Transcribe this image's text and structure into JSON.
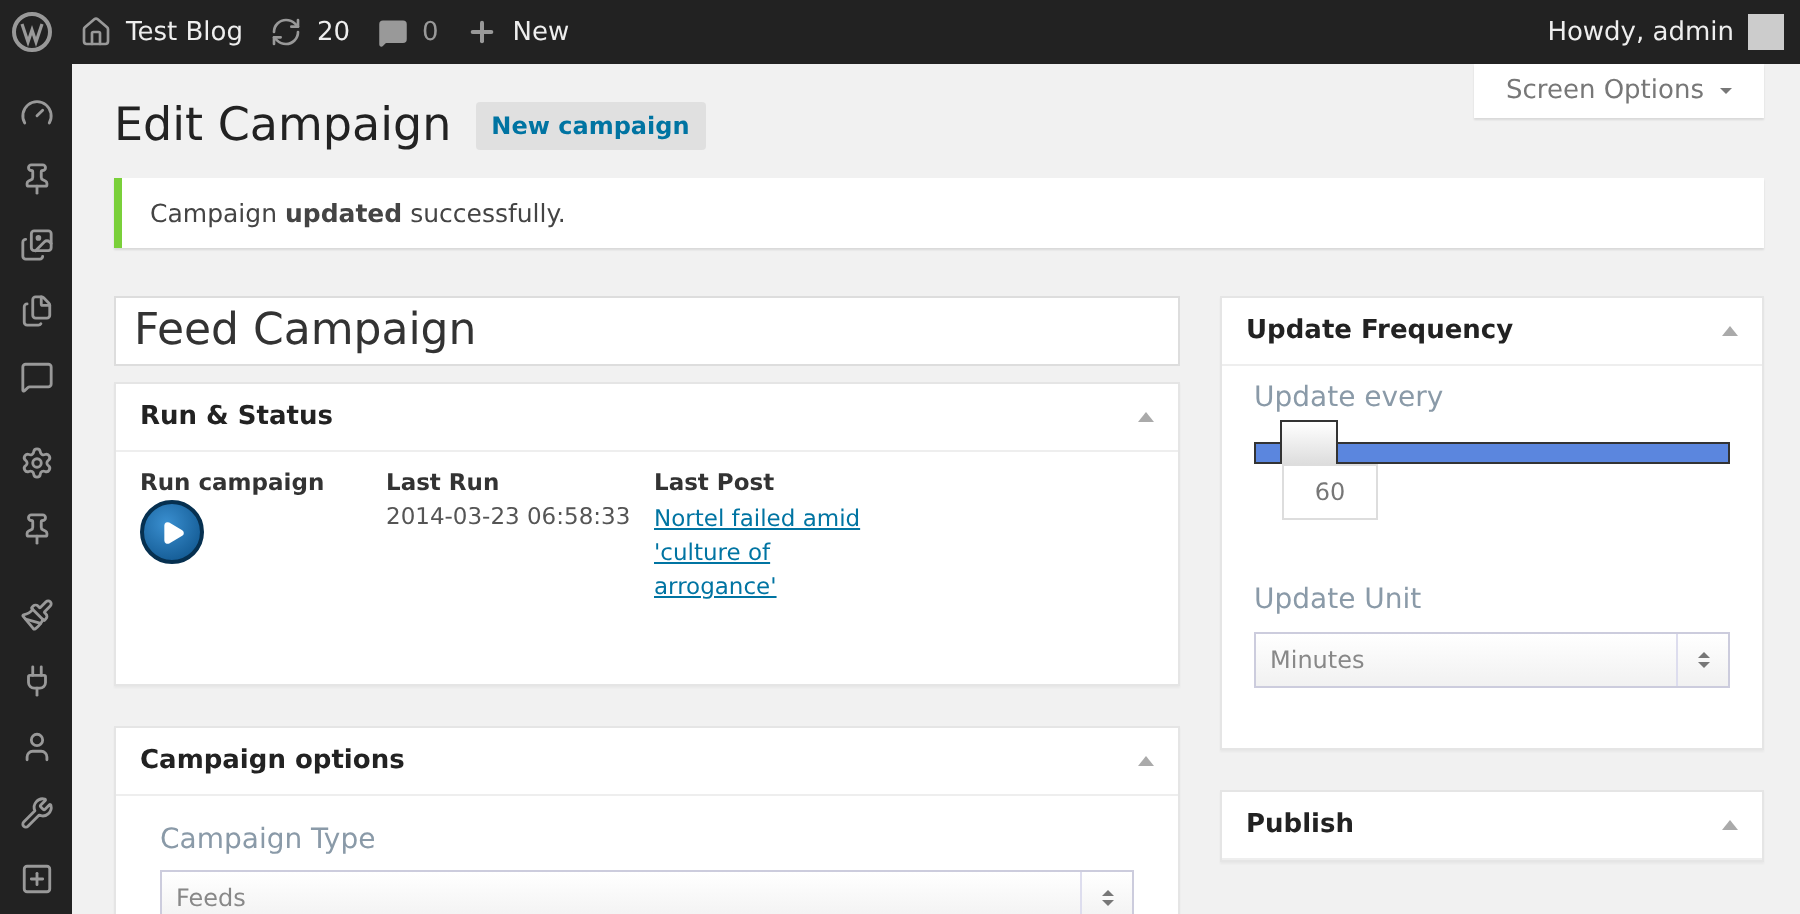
{
  "admin_bar": {
    "site": "Test Blog",
    "updates": "20",
    "comments": "0",
    "new": "New",
    "greeting": "Howdy, admin"
  },
  "sidebar": {
    "groups": [
      {
        "items": [
          {
            "kind": "gauge"
          },
          {
            "kind": "pin"
          },
          {
            "kind": "media"
          },
          {
            "kind": "pages"
          },
          {
            "kind": "comment"
          }
        ]
      },
      {
        "items": [
          {
            "kind": "gear"
          },
          {
            "kind": "pin"
          }
        ]
      },
      {
        "items": [
          {
            "kind": "brush"
          },
          {
            "kind": "plug"
          },
          {
            "kind": "user"
          },
          {
            "kind": "wrench"
          },
          {
            "kind": "plus"
          }
        ]
      }
    ]
  },
  "screen_options": "Screen Options",
  "page_title": "Edit Campaign",
  "new_button": "New campaign",
  "notice": "Campaign **updated** successfully.",
  "title_field": {
    "value": "Feed Campaign"
  },
  "run_status": {
    "title": "Run & Status",
    "expanded": true,
    "run_label": "Run campaign",
    "last_run_label": "Last Run",
    "last_run": "2014-03-23 06:58:33",
    "last_post_label": "Last Post",
    "last_post": "Nortel failed amid 'culture of arrogance'"
  },
  "campaign_options": {
    "title": "Campaign options",
    "expanded": true,
    "type_label": "Campaign Type",
    "type_value": "Feeds"
  },
  "update_frequency": {
    "title": "Update Frequency",
    "expanded": true,
    "every_label": "Update every",
    "level": 0.06,
    "value": "60",
    "unit_label": "Update Unit",
    "unit_value": "Minutes"
  },
  "publish": {
    "title": "Publish",
    "expanded": true
  }
}
